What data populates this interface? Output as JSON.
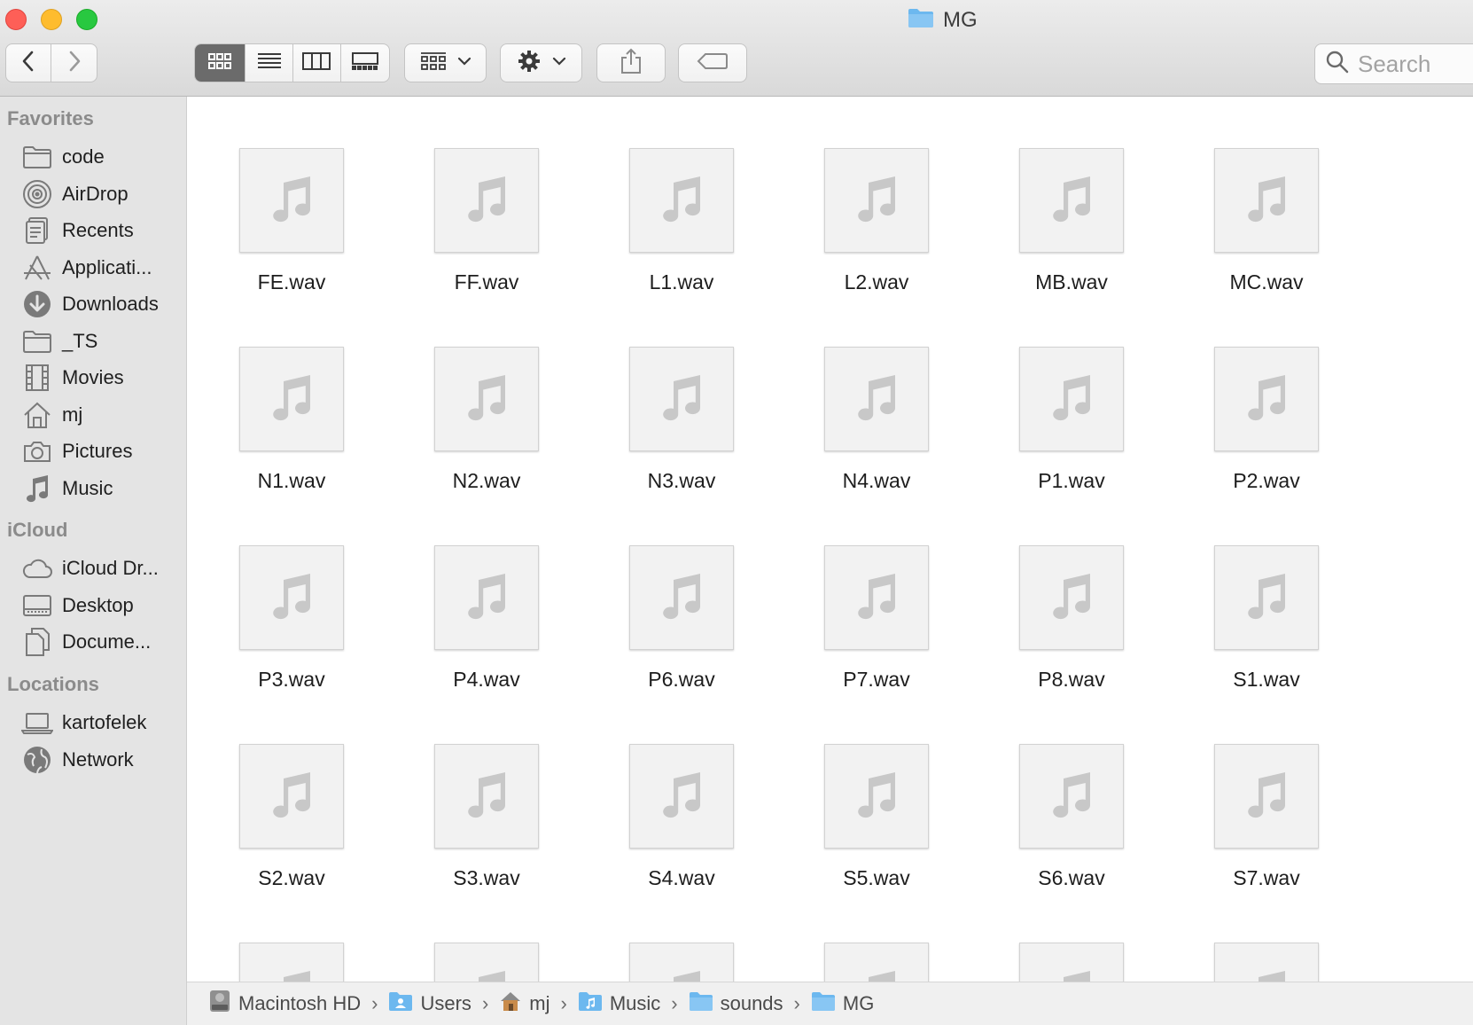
{
  "window": {
    "title": "MG"
  },
  "toolbar": {
    "back_icon": "chevron-left-icon",
    "forward_icon": "chevron-right-icon",
    "view_modes": [
      "icon-view",
      "list-view",
      "column-view",
      "gallery-view"
    ],
    "active_view": "icon-view",
    "group_icon": "group-by-icon",
    "action_icon": "gear-icon",
    "share_icon": "share-icon",
    "tag_icon": "tag-icon",
    "search_placeholder": "Search"
  },
  "sidebar": {
    "sections": [
      {
        "title": "Favorites",
        "items": [
          {
            "label": "code",
            "icon": "folder-icon"
          },
          {
            "label": "AirDrop",
            "icon": "airdrop-icon"
          },
          {
            "label": "Recents",
            "icon": "recents-icon"
          },
          {
            "label": "Applicati...",
            "icon": "applications-icon"
          },
          {
            "label": "Downloads",
            "icon": "downloads-icon"
          },
          {
            "label": "_TS",
            "icon": "folder-icon"
          },
          {
            "label": "Movies",
            "icon": "movies-icon"
          },
          {
            "label": "mj",
            "icon": "home-icon"
          },
          {
            "label": "Pictures",
            "icon": "camera-icon"
          },
          {
            "label": "Music",
            "icon": "music-note-icon"
          }
        ]
      },
      {
        "title": "iCloud",
        "items": [
          {
            "label": "iCloud Dr...",
            "icon": "cloud-icon"
          },
          {
            "label": "Desktop",
            "icon": "desktop-icon"
          },
          {
            "label": "Docume...",
            "icon": "documents-icon"
          }
        ]
      },
      {
        "title": "Locations",
        "items": [
          {
            "label": "kartofelek",
            "icon": "laptop-icon"
          },
          {
            "label": "Network",
            "icon": "globe-icon"
          }
        ]
      }
    ]
  },
  "files": [
    "FE.wav",
    "FF.wav",
    "L1.wav",
    "L2.wav",
    "MB.wav",
    "MC.wav",
    "N1.wav",
    "N2.wav",
    "N3.wav",
    "N4.wav",
    "P1.wav",
    "P2.wav",
    "P3.wav",
    "P4.wav",
    "P6.wav",
    "P7.wav",
    "P8.wav",
    "S1.wav",
    "S2.wav",
    "S3.wav",
    "S4.wav",
    "S5.wav",
    "S6.wav",
    "S7.wav"
  ],
  "partial_files_visible": 6,
  "pathbar": [
    {
      "label": "Macintosh HD",
      "icon": "hard-drive-icon"
    },
    {
      "label": "Users",
      "icon": "users-folder-icon"
    },
    {
      "label": "mj",
      "icon": "home-icon"
    },
    {
      "label": "Music",
      "icon": "music-folder-icon"
    },
    {
      "label": "sounds",
      "icon": "folder-icon"
    },
    {
      "label": "MG",
      "icon": "folder-icon"
    }
  ],
  "colors": {
    "folder_blue": "#6cb8ef",
    "icon_gray": "#c8c8c8",
    "sidebar_icon": "#7a7a7a"
  }
}
